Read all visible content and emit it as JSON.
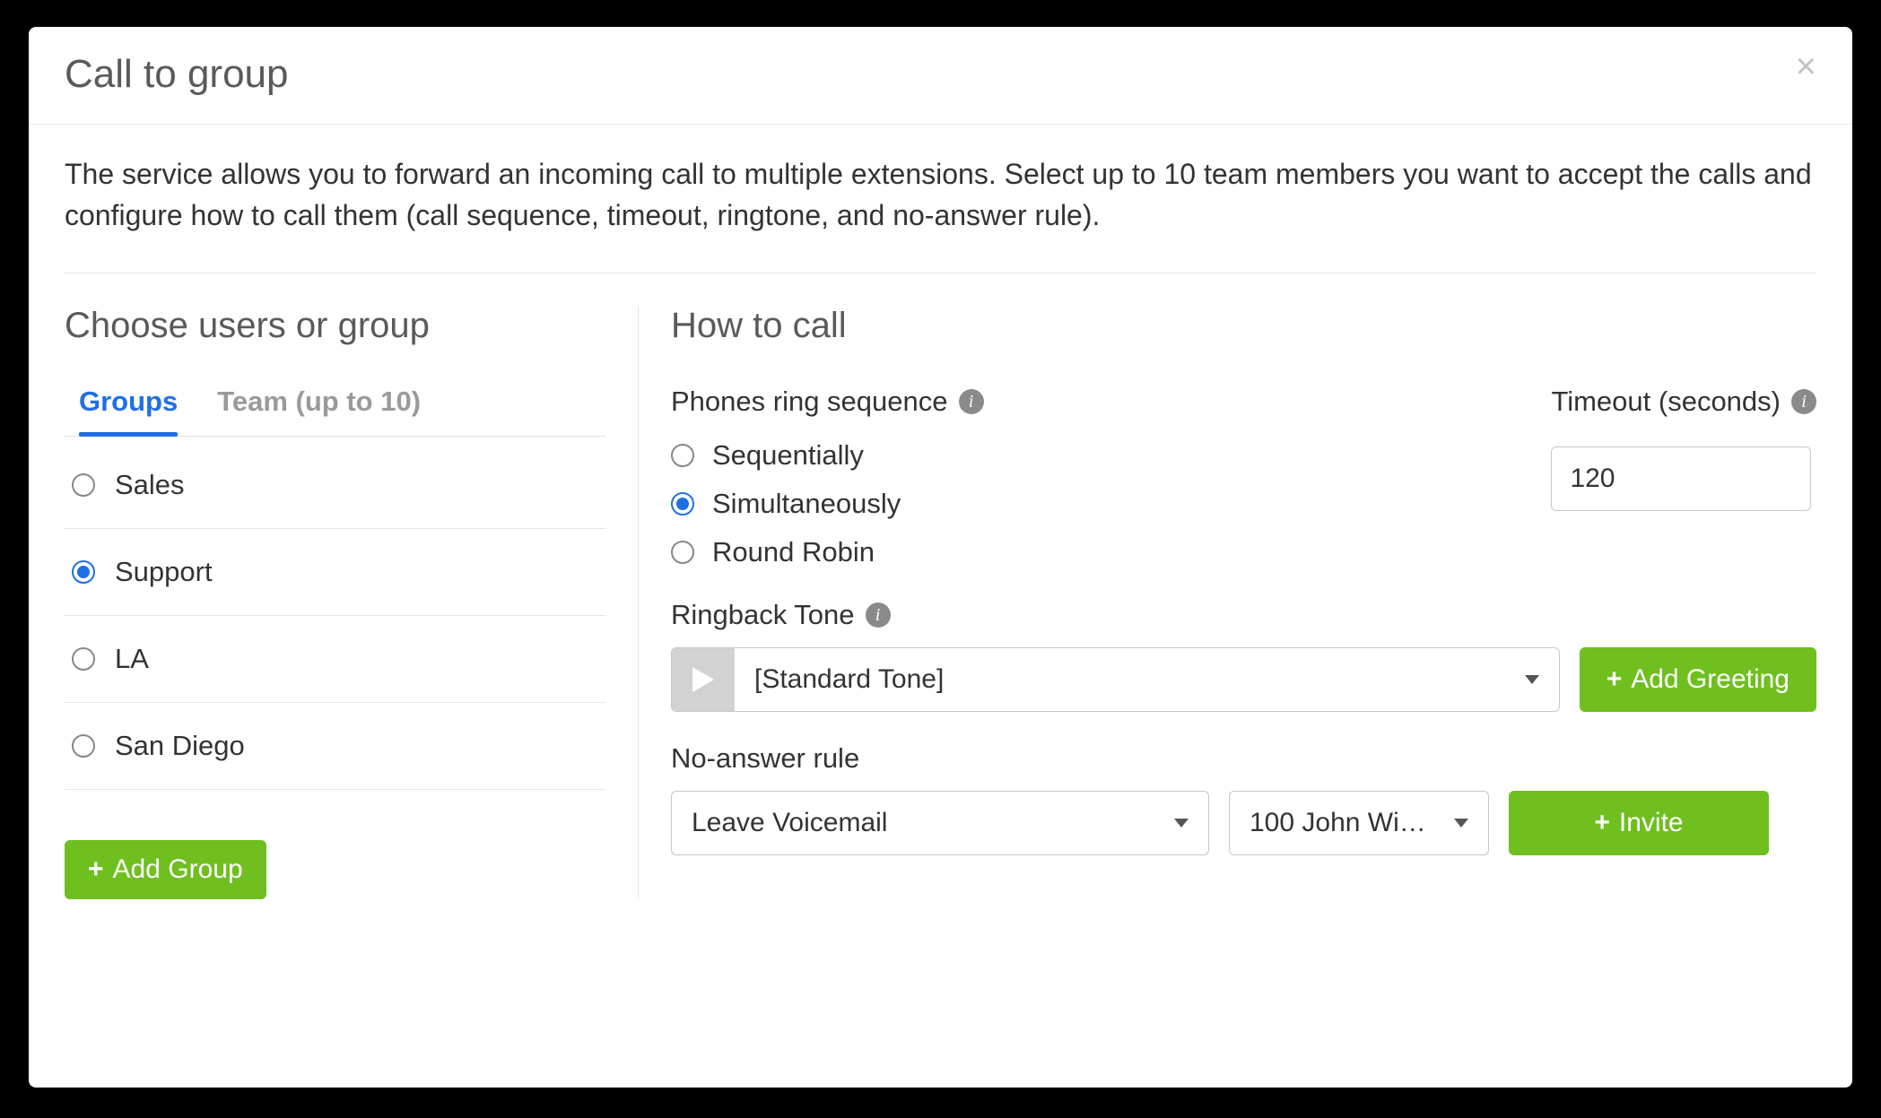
{
  "modal": {
    "title": "Call to group",
    "description": "The service allows you to forward an incoming call to multiple extensions. Select up to 10 team members you want to accept the calls and configure how to call them (call sequence, timeout, ringtone, and no-answer rule)."
  },
  "left": {
    "heading": "Choose users or group",
    "tabs": {
      "groups": "Groups",
      "team": "Team (up to 10)",
      "active": "groups"
    },
    "groups": {
      "items": [
        {
          "label": "Sales",
          "selected": false
        },
        {
          "label": "Support",
          "selected": true
        },
        {
          "label": "LA",
          "selected": false
        },
        {
          "label": "San Diego",
          "selected": false
        }
      ]
    },
    "add_group_label": "Add Group"
  },
  "right": {
    "heading": "How to call",
    "sequence": {
      "label": "Phones ring sequence",
      "options": [
        {
          "label": "Sequentially",
          "selected": false
        },
        {
          "label": "Simultaneously",
          "selected": true
        },
        {
          "label": "Round Robin",
          "selected": false
        }
      ]
    },
    "timeout": {
      "label": "Timeout (seconds)",
      "value": "120"
    },
    "ringback": {
      "label": "Ringback Tone",
      "selected": "[Standard Tone]",
      "add_button": "Add Greeting"
    },
    "noanswer": {
      "label": "No-answer rule",
      "rule_selected": "Leave Voicemail",
      "extension_selected": "100 John Wi…",
      "invite_button": "Invite"
    }
  }
}
